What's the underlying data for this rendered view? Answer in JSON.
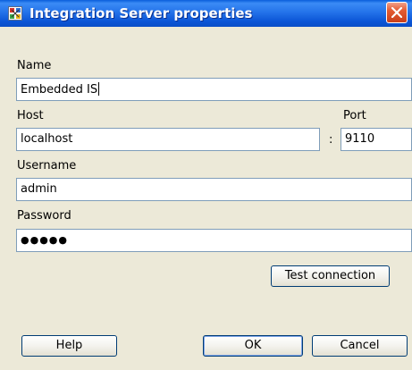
{
  "window": {
    "title": "Integration Server properties",
    "icon": "app-icon",
    "close_icon": "close-icon"
  },
  "form": {
    "name_label": "Name",
    "name_value": "Embedded IS",
    "host_label": "Host",
    "host_value": "localhost",
    "separator": ":",
    "port_label": "Port",
    "port_value": "9110",
    "username_label": "Username",
    "username_value": "admin",
    "password_label": "Password",
    "password_value": "●●●●●"
  },
  "buttons": {
    "test_connection": "Test connection",
    "help": "Help",
    "ok": "OK",
    "cancel": "Cancel"
  },
  "colors": {
    "titlebar": "#0b55d6",
    "dialog_bg": "#ece9d8",
    "field_border": "#7f9db9",
    "close_button": "#e35b32"
  }
}
